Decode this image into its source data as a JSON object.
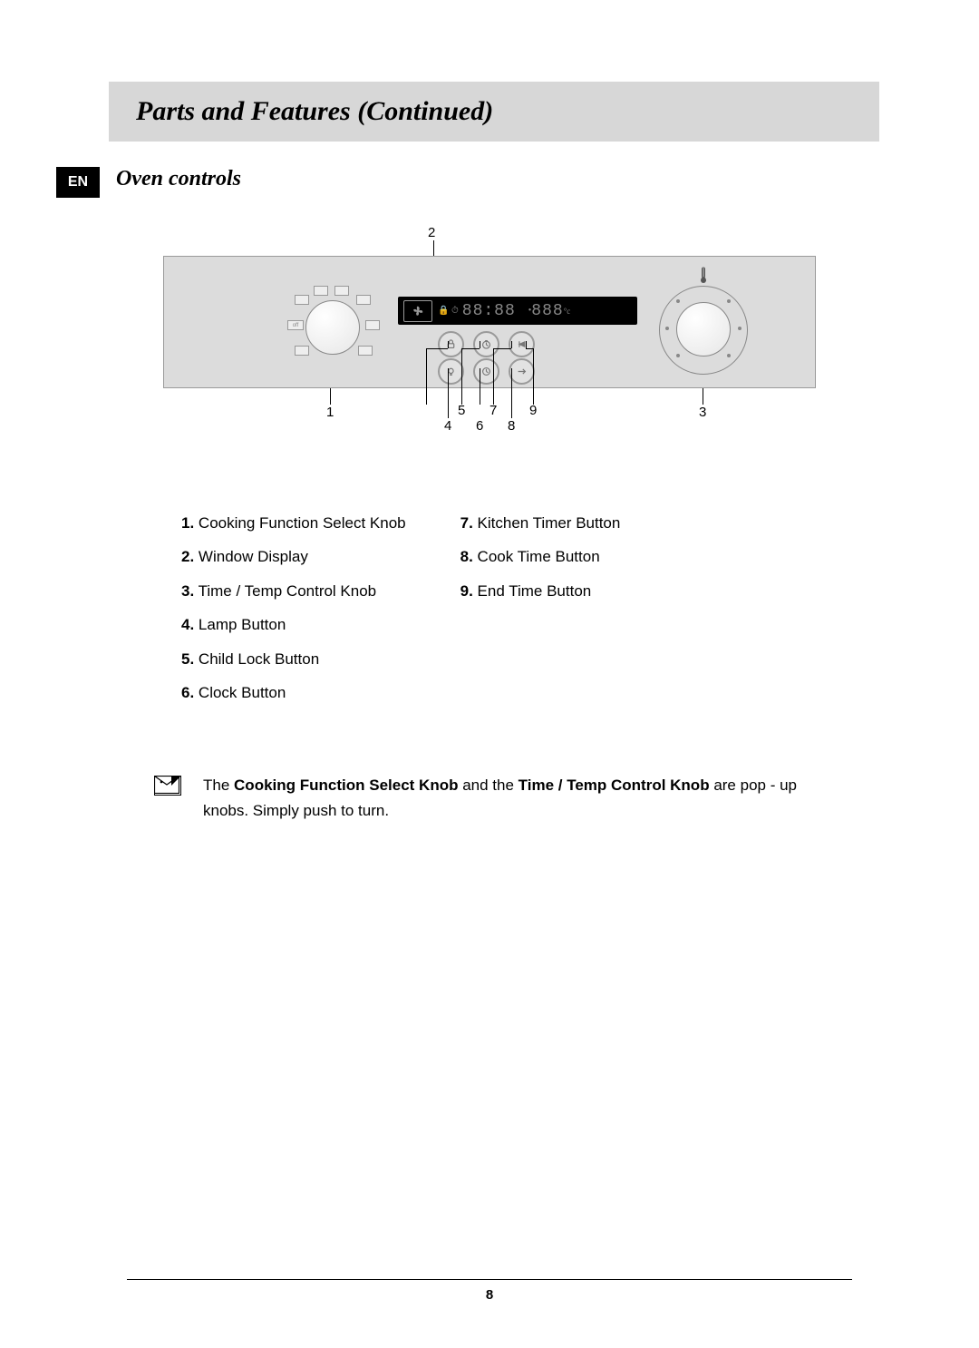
{
  "header": {
    "title": "Parts and Features (Continued)",
    "lang_badge": "EN"
  },
  "section": {
    "title": "Oven controls"
  },
  "diagram": {
    "display": {
      "time": "88:88",
      "temp": "888"
    },
    "callouts": {
      "c1": "1",
      "c2": "2",
      "c3": "3",
      "c4": "4",
      "c5": "5",
      "c6": "6",
      "c7": "7",
      "c8": "8",
      "c9": "9"
    }
  },
  "legend": {
    "col1": [
      {
        "n": "1.",
        "t": "Cooking Function Select Knob"
      },
      {
        "n": "2.",
        "t": "Window Display"
      },
      {
        "n": "3.",
        "t": "Time / Temp Control Knob"
      },
      {
        "n": "4.",
        "t": "Lamp Button"
      },
      {
        "n": "5.",
        "t": "Child Lock Button"
      },
      {
        "n": "6.",
        "t": "Clock Button"
      }
    ],
    "col2": [
      {
        "n": "7.",
        "t": "Kitchen Timer Button"
      },
      {
        "n": "8.",
        "t": "Cook Time Button"
      },
      {
        "n": "9.",
        "t": "End Time Button"
      }
    ]
  },
  "note": {
    "pre": "The ",
    "b1": "Cooking Function Select Knob",
    "mid": " and the ",
    "b2": "Time / Temp Control Knob",
    "post": " are pop - up knobs. Simply push to turn."
  },
  "page_number": "8"
}
